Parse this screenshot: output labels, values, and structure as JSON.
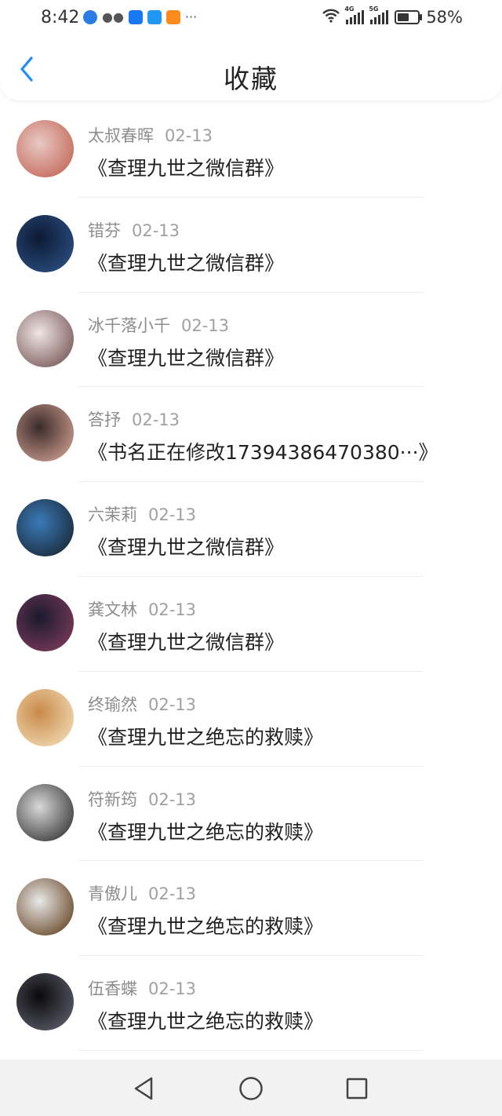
{
  "status": {
    "time": "8:42",
    "battery": "58%",
    "net1": "4G",
    "net2": "5G"
  },
  "header": {
    "title": "收藏"
  },
  "items": [
    {
      "name": "太叔春晖",
      "date": "02-13",
      "book": "《查理九世之微信群》",
      "avatar_colors": [
        "#e8c8c4",
        "#c46a5a"
      ]
    },
    {
      "name": "错芬",
      "date": "02-13",
      "book": "《查理九世之微信群》",
      "avatar_colors": [
        "#0d1a33",
        "#2a4d80"
      ]
    },
    {
      "name": "冰千落小千",
      "date": "02-13",
      "book": "《查理九世之微信群》",
      "avatar_colors": [
        "#efe6e4",
        "#7a5a5a"
      ]
    },
    {
      "name": "答抒",
      "date": "02-13",
      "book": "《书名正在修改17394386470380···》",
      "avatar_colors": [
        "#3a2a2a",
        "#c89a8c"
      ]
    },
    {
      "name": "六茉莉",
      "date": "02-13",
      "book": "《查理九世之微信群》",
      "avatar_colors": [
        "#3a7ab8",
        "#1a2a3a"
      ]
    },
    {
      "name": "龚文林",
      "date": "02-13",
      "book": "《查理九世之微信群》",
      "avatar_colors": [
        "#1a1a2e",
        "#7a3a5a"
      ]
    },
    {
      "name": "终瑜然",
      "date": "02-13",
      "book": "《查理九世之绝忘的救赎》",
      "avatar_colors": [
        "#c88a4a",
        "#f0d8b0"
      ]
    },
    {
      "name": "符新筠",
      "date": "02-13",
      "book": "《查理九世之绝忘的救赎》",
      "avatar_colors": [
        "#d8d8d8",
        "#3a3a3a"
      ]
    },
    {
      "name": "青傲儿",
      "date": "02-13",
      "book": "《查理九世之绝忘的救赎》",
      "avatar_colors": [
        "#e8e8e8",
        "#6a4a2a"
      ]
    },
    {
      "name": "伍香蝶",
      "date": "02-13",
      "book": "《查理九世之绝忘的救赎》",
      "avatar_colors": [
        "#0a0a0a",
        "#5a5a6a"
      ]
    }
  ],
  "colors": {
    "accent": "#1a8cff",
    "name_text": "#8d8d8d",
    "book_text": "#222222",
    "navbar": "#f2f2f2"
  }
}
